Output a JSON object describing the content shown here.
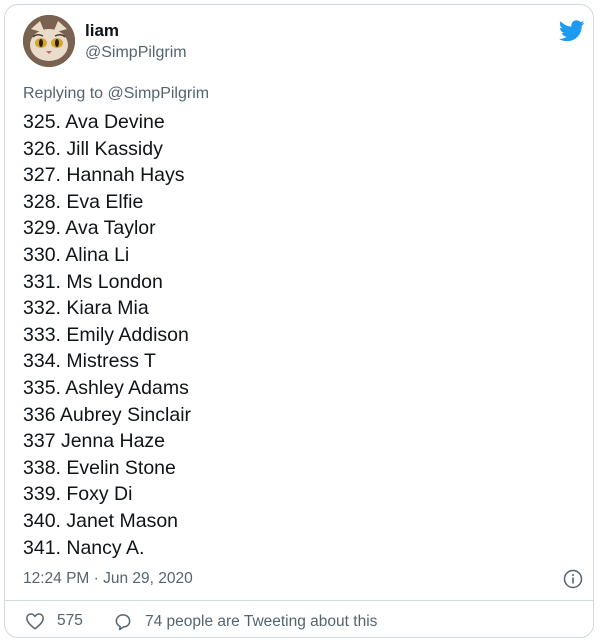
{
  "user": {
    "display_name": "liam",
    "handle": "@SimpPilgrim",
    "avatar_icon": "cat-face-avatar"
  },
  "platform": {
    "logo": "twitter-bird-icon",
    "accent": "#1d9bf0"
  },
  "replying": {
    "prefix": "Replying to ",
    "target": "@SimpPilgrim"
  },
  "tweet": {
    "lines": [
      "325. Ava Devine",
      "326. Jill Kassidy",
      "327. Hannah Hays",
      "328. Eva Elfie",
      "329. Ava Taylor",
      "330. Alina Li",
      "331. Ms London",
      "332. Kiara Mia",
      "333. Emily Addison",
      "334. Mistress T",
      "335. Ashley Adams",
      "336 Aubrey Sinclair",
      "337 Jenna Haze",
      "338. Evelin Stone",
      "339. Foxy Di",
      "340. Janet Mason",
      "341. Nancy A."
    ],
    "timestamp": "12:24 PM · Jun 29, 2020"
  },
  "footer": {
    "likes_count": "575",
    "tweeting_text": "74 people are Tweeting about this"
  }
}
